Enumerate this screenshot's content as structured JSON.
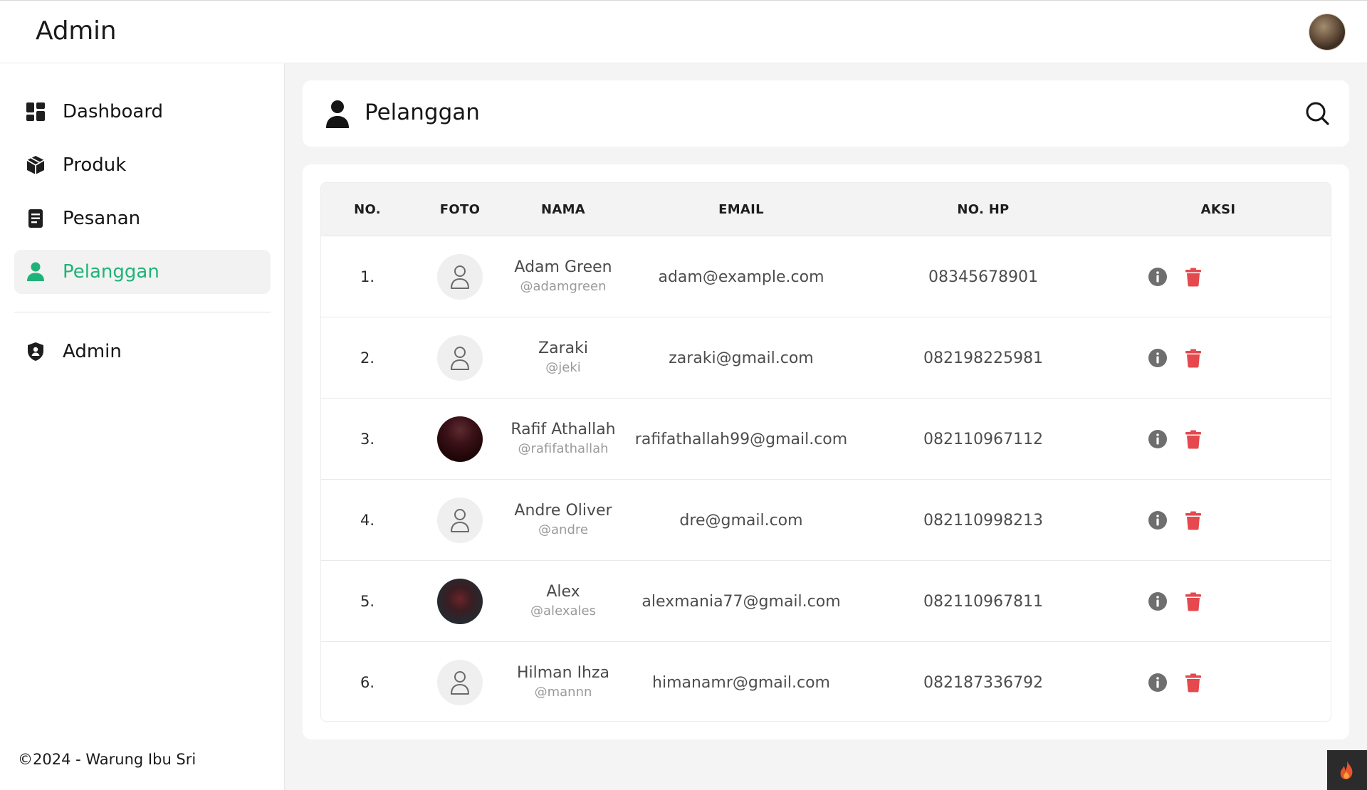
{
  "header": {
    "brand": "Admin"
  },
  "sidebar": {
    "items": [
      {
        "label": "Dashboard",
        "icon": "dashboard-icon"
      },
      {
        "label": "Produk",
        "icon": "box-icon"
      },
      {
        "label": "Pesanan",
        "icon": "document-icon"
      },
      {
        "label": "Pelanggan",
        "icon": "user-icon",
        "active": true
      },
      {
        "label": "Admin",
        "icon": "shield-icon"
      }
    ],
    "footer": "©2024 - Warung Ibu Sri"
  },
  "page": {
    "title": "Pelanggan",
    "icon": "user-icon",
    "search_icon": "search-icon"
  },
  "table": {
    "columns": [
      "NO.",
      "FOTO",
      "NAMA",
      "EMAIL",
      "NO. HP",
      "AKSI"
    ],
    "rows": [
      {
        "no": "1.",
        "photo": "default",
        "name": "Adam Green",
        "username": "@adamgreen",
        "email": "adam@example.com",
        "phone": "08345678901"
      },
      {
        "no": "2.",
        "photo": "default",
        "name": "Zaraki",
        "username": "@jeki",
        "email": "zaraki@gmail.com",
        "phone": "082198225981"
      },
      {
        "no": "3.",
        "photo": "picture",
        "name": "Rafif Athallah",
        "username": "@rafifathallah",
        "email": "rafifathallah99@gmail.com",
        "phone": "082110967112"
      },
      {
        "no": "4.",
        "photo": "default",
        "name": "Andre Oliver",
        "username": "@andre",
        "email": "dre@gmail.com",
        "phone": "082110998213"
      },
      {
        "no": "5.",
        "photo": "picture",
        "name": "Alex",
        "username": "@alexales",
        "email": "alexmania77@gmail.com",
        "phone": "082110967811"
      },
      {
        "no": "6.",
        "photo": "default",
        "name": "Hilman Ihza",
        "username": "@mannn",
        "email": "himanamr@gmail.com",
        "phone": "082187336792"
      }
    ]
  },
  "colors": {
    "accent": "#1fb37a",
    "delete": "#e5484d",
    "info": "#6e6e6e"
  }
}
